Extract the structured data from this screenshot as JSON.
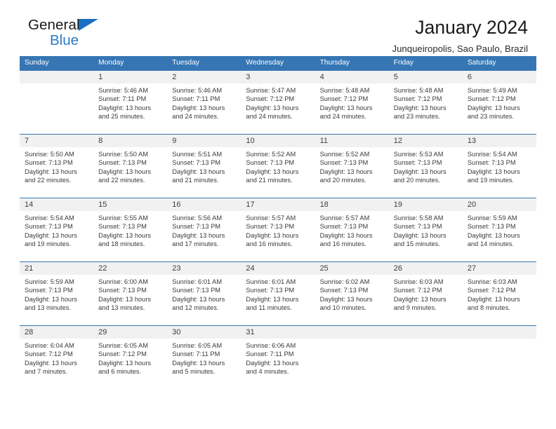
{
  "brand": {
    "name_part1": "General",
    "name_part2": "Blue",
    "triangle_color": "#1b6fc0",
    "blue_text_color": "#2a7ac4"
  },
  "header": {
    "title": "January 2024",
    "subtitle": "Junqueiropolis, Sao Paulo, Brazil"
  },
  "theme": {
    "header_blue": "#3676b4",
    "daynum_band": "#f1f1f1",
    "text": "#3a3a3a"
  },
  "weekday_headers": [
    "Sunday",
    "Monday",
    "Tuesday",
    "Wednesday",
    "Thursday",
    "Friday",
    "Saturday"
  ],
  "weeks": [
    {
      "days": [
        {
          "num": "",
          "sunrise": "",
          "sunset": "",
          "daylight_line1": "",
          "daylight_line2": ""
        },
        {
          "num": "1",
          "sunrise": "Sunrise: 5:46 AM",
          "sunset": "Sunset: 7:11 PM",
          "daylight_line1": "Daylight: 13 hours",
          "daylight_line2": "and 25 minutes."
        },
        {
          "num": "2",
          "sunrise": "Sunrise: 5:46 AM",
          "sunset": "Sunset: 7:11 PM",
          "daylight_line1": "Daylight: 13 hours",
          "daylight_line2": "and 24 minutes."
        },
        {
          "num": "3",
          "sunrise": "Sunrise: 5:47 AM",
          "sunset": "Sunset: 7:12 PM",
          "daylight_line1": "Daylight: 13 hours",
          "daylight_line2": "and 24 minutes."
        },
        {
          "num": "4",
          "sunrise": "Sunrise: 5:48 AM",
          "sunset": "Sunset: 7:12 PM",
          "daylight_line1": "Daylight: 13 hours",
          "daylight_line2": "and 24 minutes."
        },
        {
          "num": "5",
          "sunrise": "Sunrise: 5:48 AM",
          "sunset": "Sunset: 7:12 PM",
          "daylight_line1": "Daylight: 13 hours",
          "daylight_line2": "and 23 minutes."
        },
        {
          "num": "6",
          "sunrise": "Sunrise: 5:49 AM",
          "sunset": "Sunset: 7:12 PM",
          "daylight_line1": "Daylight: 13 hours",
          "daylight_line2": "and 23 minutes."
        }
      ]
    },
    {
      "days": [
        {
          "num": "7",
          "sunrise": "Sunrise: 5:50 AM",
          "sunset": "Sunset: 7:13 PM",
          "daylight_line1": "Daylight: 13 hours",
          "daylight_line2": "and 22 minutes."
        },
        {
          "num": "8",
          "sunrise": "Sunrise: 5:50 AM",
          "sunset": "Sunset: 7:13 PM",
          "daylight_line1": "Daylight: 13 hours",
          "daylight_line2": "and 22 minutes."
        },
        {
          "num": "9",
          "sunrise": "Sunrise: 5:51 AM",
          "sunset": "Sunset: 7:13 PM",
          "daylight_line1": "Daylight: 13 hours",
          "daylight_line2": "and 21 minutes."
        },
        {
          "num": "10",
          "sunrise": "Sunrise: 5:52 AM",
          "sunset": "Sunset: 7:13 PM",
          "daylight_line1": "Daylight: 13 hours",
          "daylight_line2": "and 21 minutes."
        },
        {
          "num": "11",
          "sunrise": "Sunrise: 5:52 AM",
          "sunset": "Sunset: 7:13 PM",
          "daylight_line1": "Daylight: 13 hours",
          "daylight_line2": "and 20 minutes."
        },
        {
          "num": "12",
          "sunrise": "Sunrise: 5:53 AM",
          "sunset": "Sunset: 7:13 PM",
          "daylight_line1": "Daylight: 13 hours",
          "daylight_line2": "and 20 minutes."
        },
        {
          "num": "13",
          "sunrise": "Sunrise: 5:54 AM",
          "sunset": "Sunset: 7:13 PM",
          "daylight_line1": "Daylight: 13 hours",
          "daylight_line2": "and 19 minutes."
        }
      ]
    },
    {
      "days": [
        {
          "num": "14",
          "sunrise": "Sunrise: 5:54 AM",
          "sunset": "Sunset: 7:13 PM",
          "daylight_line1": "Daylight: 13 hours",
          "daylight_line2": "and 19 minutes."
        },
        {
          "num": "15",
          "sunrise": "Sunrise: 5:55 AM",
          "sunset": "Sunset: 7:13 PM",
          "daylight_line1": "Daylight: 13 hours",
          "daylight_line2": "and 18 minutes."
        },
        {
          "num": "16",
          "sunrise": "Sunrise: 5:56 AM",
          "sunset": "Sunset: 7:13 PM",
          "daylight_line1": "Daylight: 13 hours",
          "daylight_line2": "and 17 minutes."
        },
        {
          "num": "17",
          "sunrise": "Sunrise: 5:57 AM",
          "sunset": "Sunset: 7:13 PM",
          "daylight_line1": "Daylight: 13 hours",
          "daylight_line2": "and 16 minutes."
        },
        {
          "num": "18",
          "sunrise": "Sunrise: 5:57 AM",
          "sunset": "Sunset: 7:13 PM",
          "daylight_line1": "Daylight: 13 hours",
          "daylight_line2": "and 16 minutes."
        },
        {
          "num": "19",
          "sunrise": "Sunrise: 5:58 AM",
          "sunset": "Sunset: 7:13 PM",
          "daylight_line1": "Daylight: 13 hours",
          "daylight_line2": "and 15 minutes."
        },
        {
          "num": "20",
          "sunrise": "Sunrise: 5:59 AM",
          "sunset": "Sunset: 7:13 PM",
          "daylight_line1": "Daylight: 13 hours",
          "daylight_line2": "and 14 minutes."
        }
      ]
    },
    {
      "days": [
        {
          "num": "21",
          "sunrise": "Sunrise: 5:59 AM",
          "sunset": "Sunset: 7:13 PM",
          "daylight_line1": "Daylight: 13 hours",
          "daylight_line2": "and 13 minutes."
        },
        {
          "num": "22",
          "sunrise": "Sunrise: 6:00 AM",
          "sunset": "Sunset: 7:13 PM",
          "daylight_line1": "Daylight: 13 hours",
          "daylight_line2": "and 13 minutes."
        },
        {
          "num": "23",
          "sunrise": "Sunrise: 6:01 AM",
          "sunset": "Sunset: 7:13 PM",
          "daylight_line1": "Daylight: 13 hours",
          "daylight_line2": "and 12 minutes."
        },
        {
          "num": "24",
          "sunrise": "Sunrise: 6:01 AM",
          "sunset": "Sunset: 7:13 PM",
          "daylight_line1": "Daylight: 13 hours",
          "daylight_line2": "and 11 minutes."
        },
        {
          "num": "25",
          "sunrise": "Sunrise: 6:02 AM",
          "sunset": "Sunset: 7:13 PM",
          "daylight_line1": "Daylight: 13 hours",
          "daylight_line2": "and 10 minutes."
        },
        {
          "num": "26",
          "sunrise": "Sunrise: 6:03 AM",
          "sunset": "Sunset: 7:12 PM",
          "daylight_line1": "Daylight: 13 hours",
          "daylight_line2": "and 9 minutes."
        },
        {
          "num": "27",
          "sunrise": "Sunrise: 6:03 AM",
          "sunset": "Sunset: 7:12 PM",
          "daylight_line1": "Daylight: 13 hours",
          "daylight_line2": "and 8 minutes."
        }
      ]
    },
    {
      "days": [
        {
          "num": "28",
          "sunrise": "Sunrise: 6:04 AM",
          "sunset": "Sunset: 7:12 PM",
          "daylight_line1": "Daylight: 13 hours",
          "daylight_line2": "and 7 minutes."
        },
        {
          "num": "29",
          "sunrise": "Sunrise: 6:05 AM",
          "sunset": "Sunset: 7:12 PM",
          "daylight_line1": "Daylight: 13 hours",
          "daylight_line2": "and 6 minutes."
        },
        {
          "num": "30",
          "sunrise": "Sunrise: 6:05 AM",
          "sunset": "Sunset: 7:11 PM",
          "daylight_line1": "Daylight: 13 hours",
          "daylight_line2": "and 5 minutes."
        },
        {
          "num": "31",
          "sunrise": "Sunrise: 6:06 AM",
          "sunset": "Sunset: 7:11 PM",
          "daylight_line1": "Daylight: 13 hours",
          "daylight_line2": "and 4 minutes."
        },
        {
          "num": "",
          "sunrise": "",
          "sunset": "",
          "daylight_line1": "",
          "daylight_line2": ""
        },
        {
          "num": "",
          "sunrise": "",
          "sunset": "",
          "daylight_line1": "",
          "daylight_line2": ""
        },
        {
          "num": "",
          "sunrise": "",
          "sunset": "",
          "daylight_line1": "",
          "daylight_line2": ""
        }
      ]
    }
  ]
}
